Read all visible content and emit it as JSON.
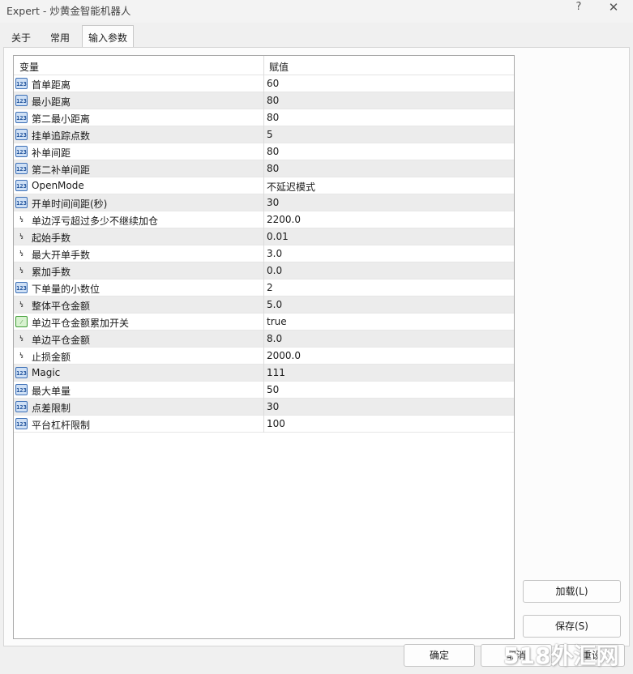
{
  "window": {
    "title": "Expert - 炒黄金智能机器人",
    "help_glyph": "?",
    "close_glyph": "✕"
  },
  "tabs": [
    {
      "label": "关于",
      "active": false
    },
    {
      "label": "常用",
      "active": false
    },
    {
      "label": "输入参数",
      "active": true
    }
  ],
  "grid": {
    "col_variable": "变量",
    "col_value": "赋值",
    "rows": [
      {
        "name": "首单距离",
        "value": "60",
        "type": "int"
      },
      {
        "name": "最小距离",
        "value": "80",
        "type": "int"
      },
      {
        "name": "第二最小距离",
        "value": "80",
        "type": "int"
      },
      {
        "name": "挂单追踪点数",
        "value": "5",
        "type": "int"
      },
      {
        "name": "补单间距",
        "value": "80",
        "type": "int"
      },
      {
        "name": "第二补单间距",
        "value": "80",
        "type": "int"
      },
      {
        "name": "OpenMode",
        "value": "不延迟模式",
        "type": "int"
      },
      {
        "name": "开单时间间距(秒)",
        "value": "30",
        "type": "int"
      },
      {
        "name": "单边浮亏超过多少不继续加仓",
        "value": "2200.0",
        "type": "double"
      },
      {
        "name": "起始手数",
        "value": "0.01",
        "type": "double"
      },
      {
        "name": "最大开单手数",
        "value": "3.0",
        "type": "double"
      },
      {
        "name": "累加手数",
        "value": "0.0",
        "type": "double"
      },
      {
        "name": "下单量的小数位",
        "value": "2",
        "type": "int"
      },
      {
        "name": "整体平仓金额",
        "value": "5.0",
        "type": "double"
      },
      {
        "name": "单边平仓金额累加开关",
        "value": "true",
        "type": "bool"
      },
      {
        "name": "单边平仓金额",
        "value": "8.0",
        "type": "double"
      },
      {
        "name": "止损金额",
        "value": "2000.0",
        "type": "double"
      },
      {
        "name": "Magic",
        "value": "111",
        "type": "int"
      },
      {
        "name": "最大单量",
        "value": "50",
        "type": "int"
      },
      {
        "name": "点差限制",
        "value": "30",
        "type": "int"
      },
      {
        "name": "平台杠杆限制",
        "value": "100",
        "type": "int"
      }
    ]
  },
  "icons": {
    "int": {
      "glyph": "123",
      "name": "integer-param-icon"
    },
    "double": {
      "glyph": "½",
      "name": "double-param-icon"
    },
    "bool": {
      "glyph": "⁄",
      "name": "bool-param-icon"
    }
  },
  "buttons": {
    "load": "加载(L)",
    "save": "保存(S)",
    "ok": "确定",
    "cancel": "取消",
    "reset": "重设"
  },
  "watermark": "518外汇网"
}
